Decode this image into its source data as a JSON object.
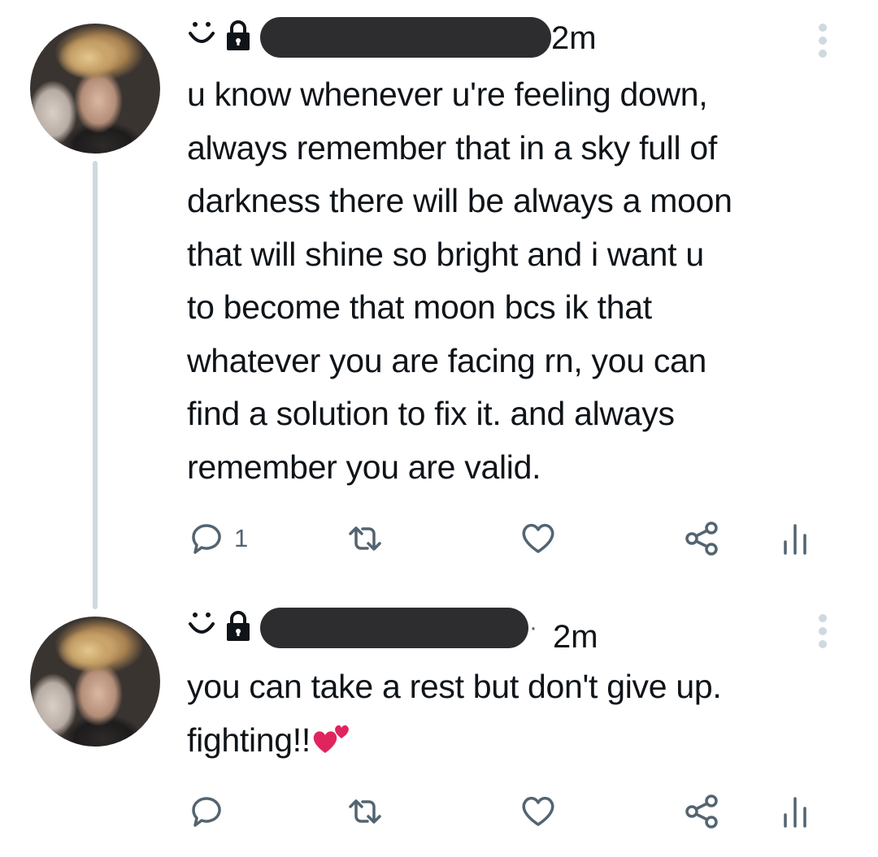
{
  "tweets": [
    {
      "time": "2m",
      "separator": "",
      "text": "u know whenever u're feeling down,\nalways remember that in a sky full of\ndarkness there will be always a moon\nthat will shine so bright and i want u\nto become that moon bcs ik that\nwhatever you are facing rn, you can\nfind a solution to fix it. and always\nremember you are valid.",
      "emoji": "",
      "reply_count": "1"
    },
    {
      "time": "2m",
      "separator": "·",
      "text": "you can take a rest but don't give up.\nfighting!!",
      "emoji": "two-hearts-emoji",
      "reply_count": ""
    }
  ],
  "icons": {
    "smiley": "smiley-icon",
    "lock": "lock-icon",
    "more": "more-options-icon",
    "reply": "reply-icon",
    "retweet": "retweet-icon",
    "like": "like-icon",
    "share": "share-icon",
    "views": "views-icon"
  },
  "colors": {
    "text": "#0f1419",
    "secondary": "#536471",
    "thread_line": "#cfd9de",
    "redaction": "#2d2d30",
    "heart": "#e0245e"
  }
}
